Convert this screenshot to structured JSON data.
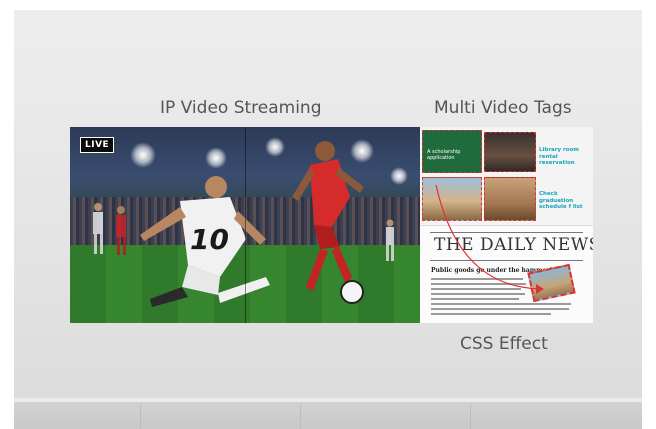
{
  "headings": {
    "left": "IP Video Streaming",
    "right_top": "Multi Video Tags",
    "right_bottom": "CSS Effect"
  },
  "video": {
    "badge": "LIVE",
    "jersey_number": "10"
  },
  "tags": {
    "green_card": "A scholarship application",
    "library": "Library room rental reservation",
    "graduation": "Check graduation schedule f list"
  },
  "news": {
    "masthead": "THE DAILY NEWS",
    "headline": "Public goods go under the hammer!"
  },
  "colors": {
    "accent_cyan": "#18a2b8",
    "tag_green": "#1f6b3b",
    "highlight_red": "#d33"
  }
}
